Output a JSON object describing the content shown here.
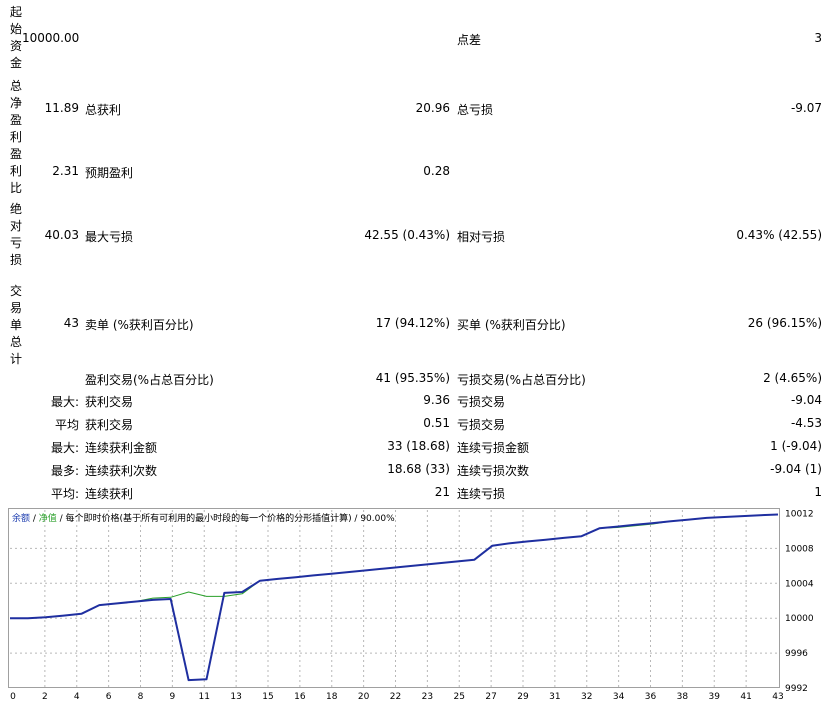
{
  "report": {
    "initial_deposit": {
      "label": "起始资金",
      "value": "10000.00"
    },
    "spread": {
      "label": "点差",
      "value": "3"
    },
    "total_net_profit": {
      "label": "总净盈利",
      "value": "11.89"
    },
    "gross_profit": {
      "label": "总获利",
      "value": "20.96"
    },
    "gross_loss": {
      "label": "总亏损",
      "value": "-9.07"
    },
    "profit_factor": {
      "label": "盈利比",
      "value": "2.31"
    },
    "expected_payoff": {
      "label": "预期盈利",
      "value": "0.28"
    },
    "absolute_drawdown": {
      "label": "绝对亏损",
      "value": "40.03"
    },
    "maximal_drawdown": {
      "label": "最大亏损",
      "value": "42.55 (0.43%)"
    },
    "relative_drawdown": {
      "label": "相对亏损",
      "value": "0.43% (42.55)"
    },
    "total_trades": {
      "label": "交易单总计",
      "value": "43"
    },
    "short_positions": {
      "label": "卖单 (%获利百分比)",
      "value": "17 (94.12%)"
    },
    "long_positions": {
      "label": "买单 (%获利百分比)",
      "value": "26 (96.15%)"
    },
    "profit_trades": {
      "label": "盈利交易(%占总百分比)",
      "value": "41 (95.35%)"
    },
    "loss_trades": {
      "label": "亏损交易(%占总百分比)",
      "value": "2 (4.65%)"
    },
    "largest": {
      "prefix": "最大:",
      "profit_label": "获利交易",
      "profit_value": "9.36",
      "loss_label": "亏损交易",
      "loss_value": "-9.04"
    },
    "average": {
      "prefix": "平均",
      "profit_label": "获利交易",
      "profit_value": "0.51",
      "loss_label": "亏损交易",
      "loss_value": "-4.53"
    },
    "max_consec_amount": {
      "prefix": "最大:",
      "win_label": "连续获利金额",
      "win_value": "33 (18.68)",
      "loss_label": "连续亏损金额",
      "loss_value": "1 (-9.04)"
    },
    "max_consec_count": {
      "prefix": "最多:",
      "win_label": "连续获利次数",
      "win_value": "18.68 (33)",
      "loss_label": "连续亏损次数",
      "loss_value": "-9.04 (1)"
    },
    "avg_consec": {
      "prefix": "平均:",
      "win_label": "连续获利",
      "win_value": "21",
      "loss_label": "连续亏损",
      "loss_value": "1"
    }
  },
  "chart_legend": {
    "balance": "余额",
    "sep1": " / ",
    "equity": "净值",
    "rest": " / 每个即时价格(基于所有可利用的最小时段的每一个价格的分形插值计算) / 90.00%"
  },
  "colors": {
    "balance": "#1f2fa0",
    "equity": "#2aa02a",
    "grid": "#b8b8b8"
  },
  "chart_data": {
    "type": "line",
    "x_ticks": [
      "0",
      "2",
      "4",
      "6",
      "8",
      "9",
      "11",
      "13",
      "15",
      "16",
      "18",
      "20",
      "22",
      "23",
      "25",
      "27",
      "29",
      "31",
      "32",
      "34",
      "36",
      "38",
      "39",
      "41",
      "43"
    ],
    "y_ticks": [
      "10012",
      "10008",
      "10004",
      "10000",
      "9996",
      "9992"
    ],
    "y_tick_values": [
      10012,
      10008,
      10004,
      10000,
      9996,
      9992
    ],
    "ylim": [
      9992,
      10012.4
    ],
    "xlim": [
      0,
      43
    ],
    "series": [
      {
        "name": "余额",
        "x": [
          0,
          1,
          2,
          3,
          4,
          5,
          6,
          7,
          8,
          9,
          10,
          11,
          12,
          13,
          14,
          15,
          16,
          17,
          18,
          19,
          20,
          21,
          22,
          23,
          24,
          25,
          26,
          27,
          28,
          29,
          30,
          31,
          32,
          33,
          34,
          35,
          36,
          37,
          38,
          39,
          40,
          41,
          42,
          43
        ],
        "y": [
          10000,
          10000,
          10000.1,
          10000.3,
          10000.5,
          10001.5,
          10001.7,
          10001.9,
          10002.1,
          10002.2,
          9992.9,
          9993,
          10002.9,
          10003,
          10004.3,
          10004.5,
          10004.7,
          10004.9,
          10005.1,
          10005.3,
          10005.5,
          10005.7,
          10005.9,
          10006.1,
          10006.3,
          10006.5,
          10006.7,
          10008.3,
          10008.6,
          10008.8,
          10009,
          10009.2,
          10009.4,
          10010.3,
          10010.5,
          10010.7,
          10010.9,
          10011.1,
          10011.3,
          10011.5,
          10011.6,
          10011.7,
          10011.8,
          10011.89
        ]
      },
      {
        "name": "净值",
        "x": [
          0,
          1,
          2,
          3,
          4,
          5,
          6,
          7,
          8,
          9,
          10,
          11,
          12,
          13,
          14,
          15,
          16,
          17,
          18,
          19,
          20,
          21,
          22,
          23,
          24,
          25,
          26,
          27,
          28,
          29,
          30,
          31,
          32,
          33,
          34,
          35,
          36,
          37,
          38,
          39,
          40,
          41,
          42,
          43
        ],
        "y": [
          10000,
          10000,
          10000.1,
          10000.3,
          10000.5,
          10001.5,
          10001.7,
          10001.9,
          10002.3,
          10002.4,
          10003,
          10002.5,
          10002.5,
          10002.8,
          10004.3,
          10004.5,
          10004.7,
          10004.9,
          10005.1,
          10005.3,
          10005.5,
          10005.7,
          10005.9,
          10006.1,
          10006.3,
          10006.5,
          10006.7,
          10008.3,
          10008.6,
          10008.8,
          10009,
          10009.2,
          10009.4,
          10010.3,
          10010.4,
          10010.6,
          10010.8,
          10011.1,
          10011.3,
          10011.5,
          10011.6,
          10011.7,
          10011.8,
          10011.89
        ]
      }
    ]
  }
}
